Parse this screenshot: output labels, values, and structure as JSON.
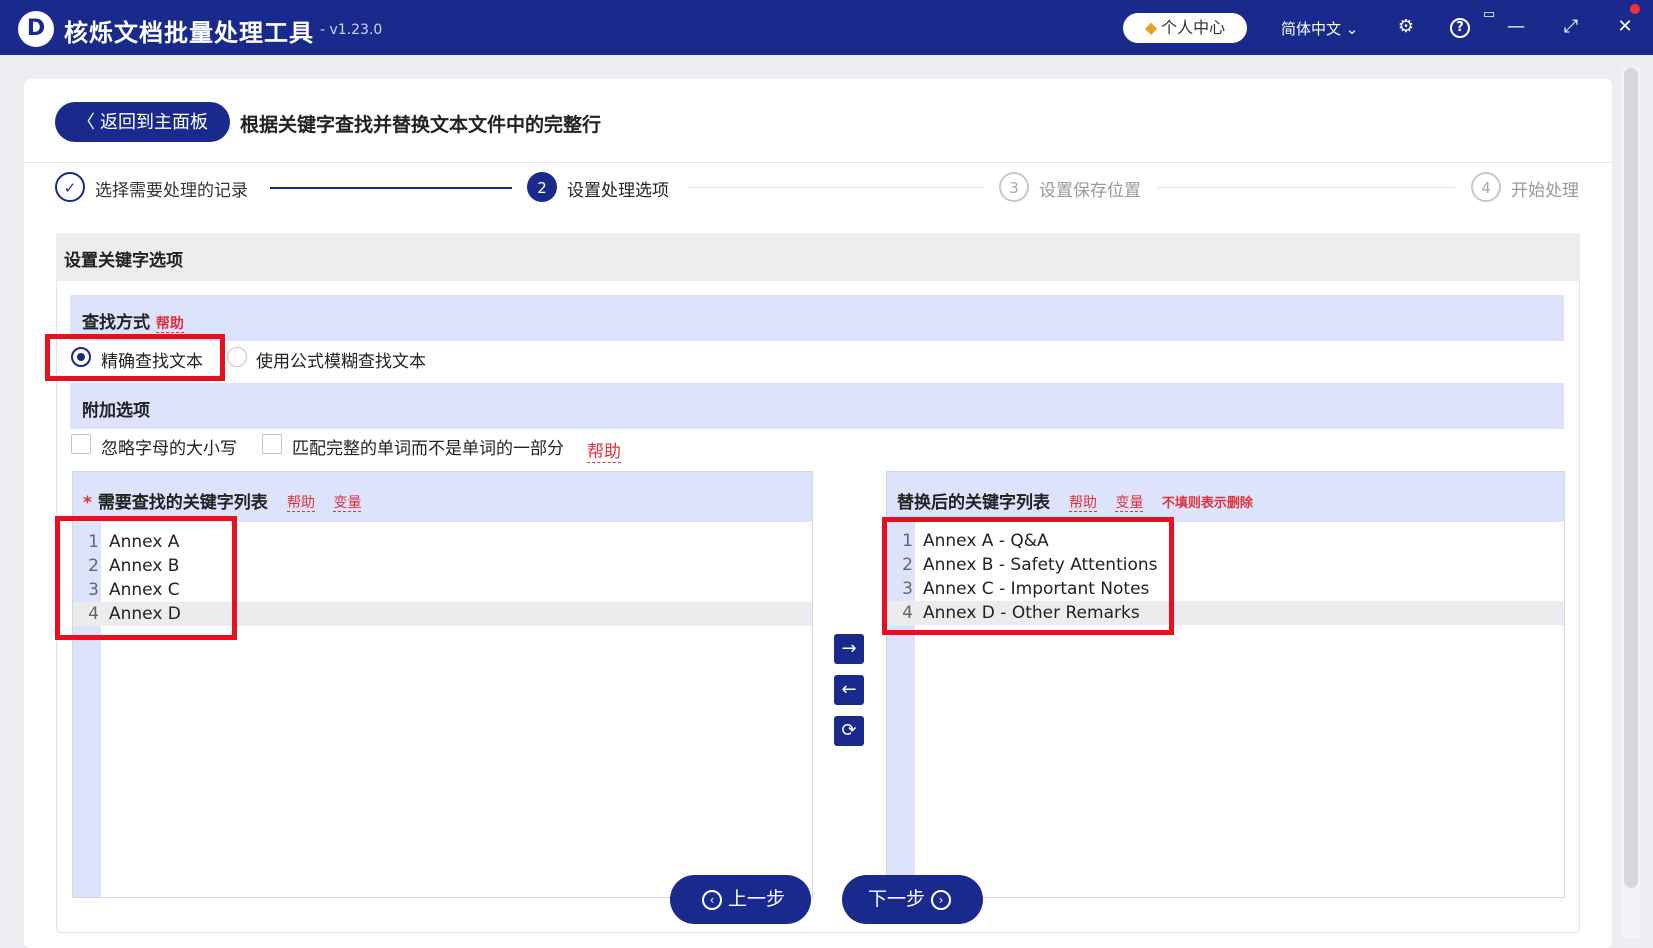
{
  "app": {
    "logo": "D",
    "title": "核烁文档批量处理工具",
    "version": "- v1.23.0"
  },
  "titlebar": {
    "user_center": "个人中心",
    "language": "简体中文",
    "icons": [
      "diamond-icon",
      "chevron-down-icon",
      "gear-icon",
      "help-icon",
      "screenshot-icon",
      "minimize-icon",
      "maximize-icon",
      "close-icon"
    ]
  },
  "header": {
    "back_label": "返回到主面板",
    "page_title": "根据关键字查找并替换文本文件中的完整行"
  },
  "steps": [
    {
      "num": "✓",
      "label": "选择需要处理的记录",
      "state": "done"
    },
    {
      "num": "2",
      "label": "设置处理选项",
      "state": "active"
    },
    {
      "num": "3",
      "label": "设置保存位置",
      "state": "todo"
    },
    {
      "num": "4",
      "label": "开始处理",
      "state": "todo"
    }
  ],
  "section": {
    "title": "设置关键字选项",
    "search_mode": {
      "title": "查找方式",
      "help": "帮助",
      "options": [
        "精确查找文本",
        "使用公式模糊查找文本"
      ],
      "selected": 0
    },
    "extra": {
      "title": "附加选项",
      "options": [
        "忽略字母的大小写",
        "匹配完整的单词而不是单词的一部分"
      ],
      "help": "帮助"
    }
  },
  "left_editor": {
    "required_mark": "*",
    "title": "需要查找的关键字列表",
    "help": "帮助",
    "variable": "变量",
    "lines": [
      "Annex A",
      "Annex B",
      "Annex C",
      "Annex D"
    ]
  },
  "right_editor": {
    "title": "替换后的关键字列表",
    "help": "帮助",
    "variable": "变量",
    "hint": "不填则表示删除",
    "lines": [
      "Annex A - Q&A",
      "Annex B - Safety Attentions",
      "Annex C - Important Notes",
      "Annex D - Other Remarks"
    ]
  },
  "mid_buttons": [
    "arrow-right-icon",
    "arrow-left-icon",
    "refresh-icon"
  ],
  "nav": {
    "prev": "上一步",
    "next": "下一步"
  },
  "colors": {
    "primary": "#1a2a8c",
    "accent_red": "#e0323c",
    "highlight_red": "#e8101e",
    "editor_head": "#dce3fb"
  }
}
